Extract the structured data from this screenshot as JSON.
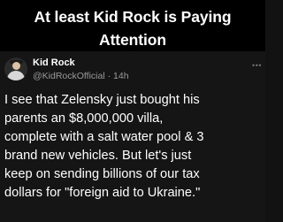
{
  "headline": {
    "lines": [
      "At least Kid Rock is Paying",
      "Attention"
    ]
  },
  "post": {
    "author_name": "Kid Rock",
    "handle": "@KidRockOfficial",
    "separator": " · ",
    "time_ago": "14h",
    "more_icon": "more-dots-icon",
    "text_lines": [
      "I see that Zelensky just bought his",
      "parents an $8,000,000 villa,",
      "complete with a salt water pool & 3",
      "brand new vehicles. But let's just",
      "keep on sending billions of our tax",
      "dollars for \"foreign aid to Ukraine.\""
    ]
  }
}
